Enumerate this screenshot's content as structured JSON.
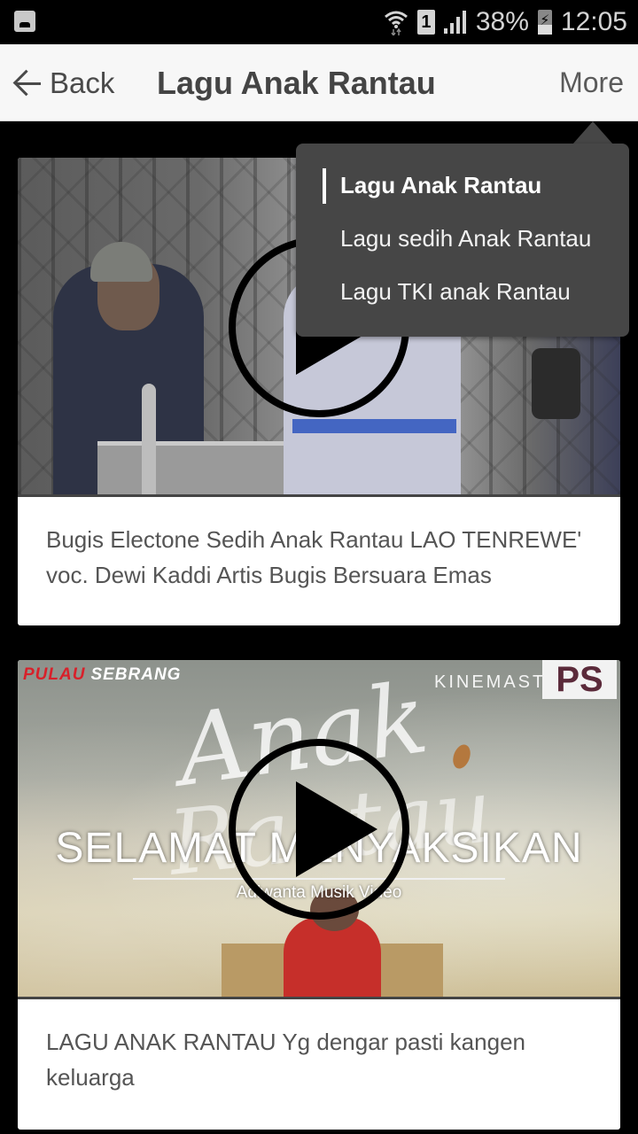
{
  "status_bar": {
    "notification_icon": "gallery-icon",
    "wifi_icon": "wifi-data-icon",
    "sim_label": "1",
    "signal_icon": "signal-strength-icon",
    "battery_percent": "38%",
    "battery_icon": "battery-charging-icon",
    "time": "12:05"
  },
  "app_bar": {
    "back_label": "Back",
    "back_icon": "arrow-left-icon",
    "title": "Lagu Anak Rantau",
    "more_label": "More"
  },
  "dropdown_menu": {
    "items": [
      {
        "label": "Lagu Anak Rantau",
        "selected": true
      },
      {
        "label": "Lagu sedih Anak Rantau",
        "selected": false
      },
      {
        "label": "Lagu TKI anak Rantau",
        "selected": false
      }
    ]
  },
  "videos": [
    {
      "title": "Bugis Electone Sedih Anak Rantau LAO TENREWE' voc. Dewi Kaddi Artis Bugis Bersuara Emas",
      "play_icon": "play-icon"
    },
    {
      "title": "LAGU ANAK RANTAU Yg dengar pasti kangen keluarga",
      "play_icon": "play-icon",
      "thumbnail_text": {
        "top_left_red": "PULAU",
        "top_left": "SEBRANG",
        "watermark": "KINEMASTER",
        "badge": "PS",
        "script_1": "Anak",
        "script_2": "Rantau",
        "headline": "SELAMAT MENYAKSIKAN",
        "subline": "Adiwanta Musik Video"
      }
    }
  ]
}
